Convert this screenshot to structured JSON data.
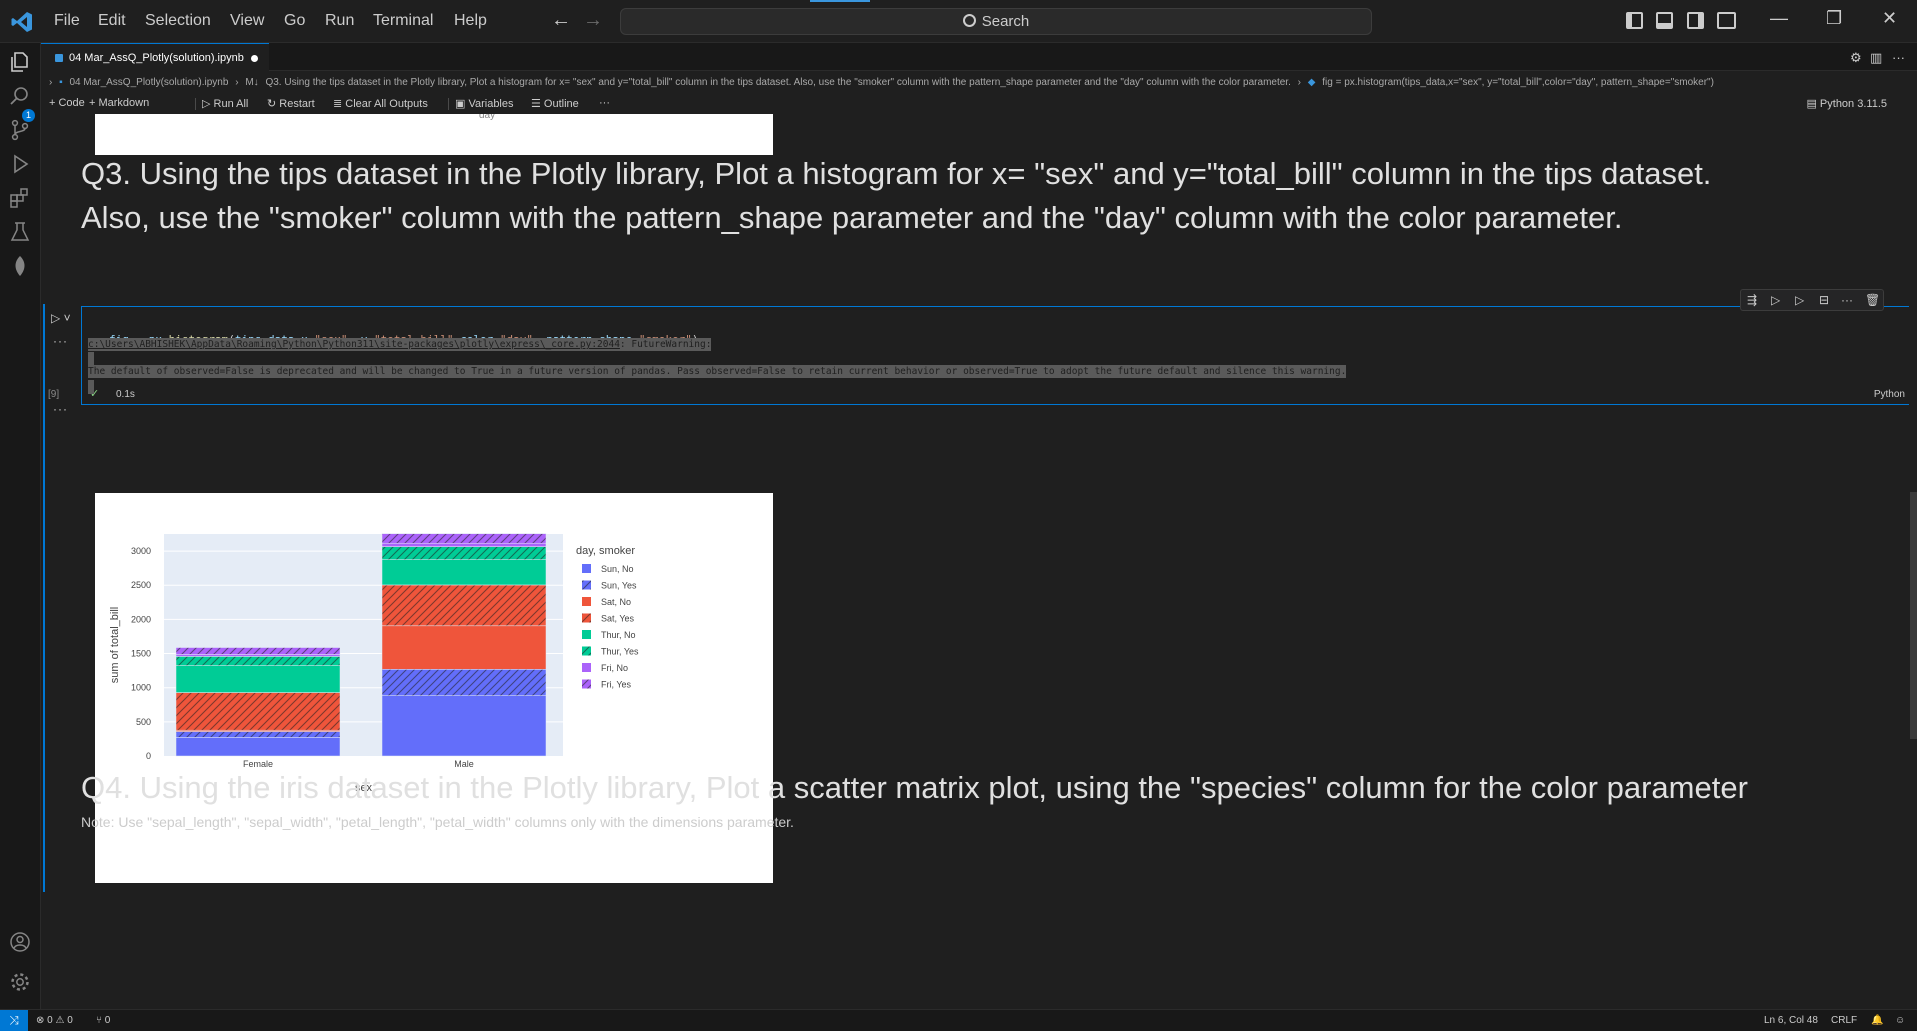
{
  "menu": [
    "File",
    "Edit",
    "Selection",
    "View",
    "Go",
    "Run",
    "Terminal",
    "Help"
  ],
  "search_label": "Search",
  "tab": {
    "title": "04 Mar_AssQ_Plotly(solution).ipynb"
  },
  "breadcrumb": {
    "file": "04 Mar_AssQ_Plotly(solution).ipynb",
    "md_prefix": "M↓",
    "section": "Q3. Using the tips dataset in the Plotly library, Plot a histogram for x= \"sex\" and y=\"total_bill\" column in the tips dataset. Also, use the \"smoker\" column with the pattern_shape parameter and the \"day\" column with the color parameter.",
    "code": "fig = px.histogram(tips_data,x=\"sex\", y=\"total_bill\",color=\"day\", pattern_shape=\"smoker\")"
  },
  "toolbar": {
    "code": "Code",
    "markdown": "Markdown",
    "run_all": "Run All",
    "restart": "Restart",
    "clear_all": "Clear All Outputs",
    "variables": "Variables",
    "outline": "Outline",
    "more": "···",
    "kernel": "Python 3.11.5"
  },
  "prev_output_label": "day",
  "q3": {
    "line1": "Q3. Using the tips dataset in the Plotly library, Plot a histogram for x= \"sex\" and y=\"total_bill\" column in the tips dataset.",
    "line2": "Also, use the \"smoker\" column with the pattern_shape parameter and the \"day\" column with the color parameter."
  },
  "cell": {
    "exec_count": "[9]",
    "exec_time": "0.1s",
    "language": "Python"
  },
  "output": {
    "warning_path": "c:\\Users\\ABHISHEK\\AppData\\Roaming\\Python\\Python311\\site-packages\\plotly\\express\\_core.py:2044",
    "warning_type": ": FutureWarning:",
    "warning_message": "The default of observed=False is deprecated and will be changed to True in a future version of pandas. Pass observed=False to retain current behavior or observed=True to adopt the future default and silence this warning."
  },
  "chart_data": {
    "type": "bar",
    "stacked": true,
    "categories": [
      "Female",
      "Male"
    ],
    "xlabel": "sex",
    "ylabel": "sum of total_bill",
    "ylim": [
      0,
      3250
    ],
    "yticks": [
      0,
      500,
      1000,
      1500,
      2000,
      2500,
      3000
    ],
    "legend_title": "day, smoker",
    "legend_position": "top-right",
    "series": [
      {
        "name": "Sun, No",
        "color": "#636efa",
        "pattern": "none",
        "values": [
          273,
          883
        ]
      },
      {
        "name": "Sun, Yes",
        "color": "#636efa",
        "pattern": "slash",
        "values": [
          85,
          386
        ]
      },
      {
        "name": "Sat, No",
        "color": "#ef553b",
        "pattern": "none",
        "values": [
          20,
          637
        ]
      },
      {
        "name": "Sat, Yes",
        "color": "#ef553b",
        "pattern": "slash",
        "values": [
          551,
          598
        ]
      },
      {
        "name": "Thur, No",
        "color": "#00cc96",
        "pattern": "none",
        "values": [
          394,
          370
        ]
      },
      {
        "name": "Thur, Yes",
        "color": "#00cc96",
        "pattern": "slash",
        "values": [
          135,
          191
        ]
      },
      {
        "name": "Fri, No",
        "color": "#ab63fa",
        "pattern": "none",
        "values": [
          30,
          50
        ]
      },
      {
        "name": "Fri, Yes",
        "color": "#ab63fa",
        "pattern": "slash",
        "values": [
          100,
          140
        ]
      }
    ]
  },
  "q4": {
    "heading": "Q4. Using the iris dataset in the Plotly library, Plot a scatter matrix plot, using the \"species\" column for the color parameter",
    "note": "Note: Use \"sepal_length\", \"sepal_width\", \"petal_length\", \"petal_width\" columns only with the dimensions parameter."
  },
  "status": {
    "errors": "0",
    "warnings": "0",
    "ports": "0",
    "cursor": "Ln 6, Col 48",
    "eol": "CRLF"
  }
}
